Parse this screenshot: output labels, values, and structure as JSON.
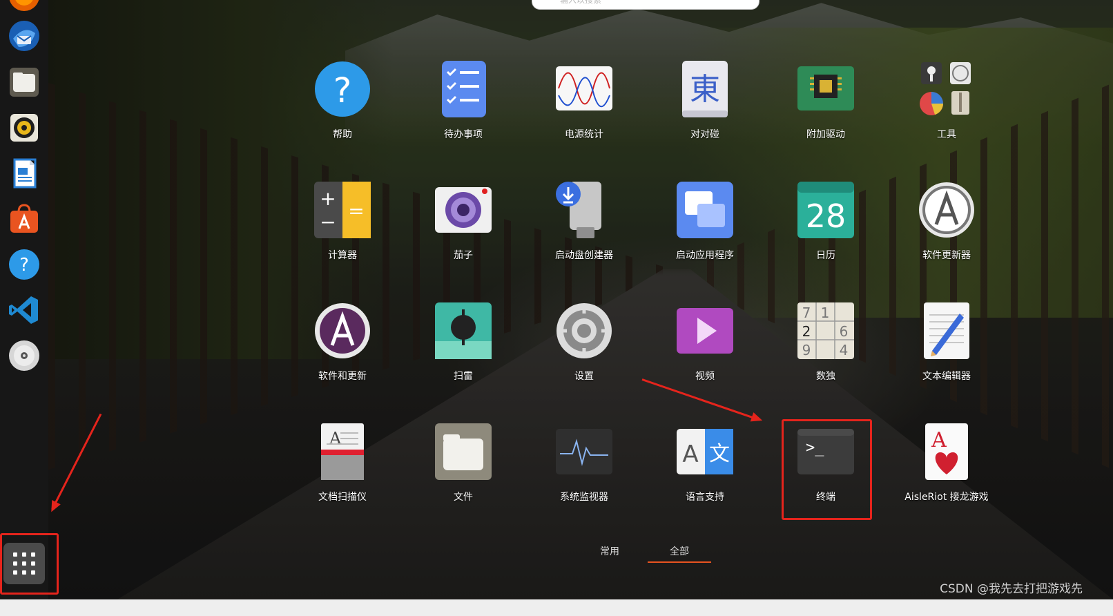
{
  "search": {
    "placeholder": "输入以搜索"
  },
  "dock": {
    "items": [
      {
        "name": "firefox-icon",
        "color": "#e66000"
      },
      {
        "name": "thunderbird-icon",
        "color": "#2a7fd4"
      },
      {
        "name": "files-icon",
        "color": "#d8d5cc"
      },
      {
        "name": "rhythmbox-icon",
        "color": "#e8b71a"
      },
      {
        "name": "libreoffice-writer-icon",
        "color": "#2a7fd4"
      },
      {
        "name": "app-center-icon",
        "color": "#e95420"
      },
      {
        "name": "help-icon",
        "color": "#2d9ae8"
      },
      {
        "name": "vscode-icon",
        "color": "#1f8ad2"
      },
      {
        "name": "optical-drive-icon",
        "color": "#d0d0d0"
      }
    ],
    "show_apps_icon": "grid-icon"
  },
  "apps": [
    {
      "label": "帮助",
      "icon": "help-icon"
    },
    {
      "label": "待办事项",
      "icon": "todo-icon"
    },
    {
      "label": "电源统计",
      "icon": "power-statistics-icon"
    },
    {
      "label": "对对碰",
      "icon": "mahjongg-icon"
    },
    {
      "label": "附加驱动",
      "icon": "additional-drivers-icon"
    },
    {
      "label": "工具",
      "icon": "utilities-folder-icon"
    },
    {
      "label": "计算器",
      "icon": "calculator-icon"
    },
    {
      "label": "茄子",
      "icon": "cheese-camera-icon"
    },
    {
      "label": "启动盘创建器",
      "icon": "startup-disk-creator-icon"
    },
    {
      "label": "启动应用程序",
      "icon": "startup-applications-icon"
    },
    {
      "label": "日历",
      "icon": "calendar-icon",
      "calendar_day": "28"
    },
    {
      "label": "软件更新器",
      "icon": "software-updater-icon"
    },
    {
      "label": "软件和更新",
      "icon": "software-properties-icon"
    },
    {
      "label": "扫雷",
      "icon": "mines-icon"
    },
    {
      "label": "设置",
      "icon": "settings-gear-icon"
    },
    {
      "label": "视频",
      "icon": "videos-play-icon"
    },
    {
      "label": "数独",
      "icon": "sudoku-icon",
      "sudoku_digits": [
        "7",
        "1",
        "2",
        "6",
        "9",
        "4"
      ]
    },
    {
      "label": "文本编辑器",
      "icon": "text-editor-icon"
    },
    {
      "label": "文档扫描仪",
      "icon": "document-scanner-icon"
    },
    {
      "label": "文件",
      "icon": "files-folder-icon"
    },
    {
      "label": "系统监视器",
      "icon": "system-monitor-icon"
    },
    {
      "label": "语言支持",
      "icon": "language-support-icon",
      "glyphs": [
        "A",
        "文"
      ]
    },
    {
      "label": "终端",
      "icon": "terminal-icon",
      "prompt": ">_"
    },
    {
      "label": "AisleRiot 接龙游戏",
      "icon": "aisleriot-cards-icon",
      "card_letter": "A"
    }
  ],
  "tabs": {
    "frequent": "常用",
    "all": "全部",
    "active": "all"
  },
  "watermark": "CSDN @我先去打把游戏先",
  "colors": {
    "annotation_red": "#e5241c",
    "ubuntu_orange": "#e95420"
  }
}
